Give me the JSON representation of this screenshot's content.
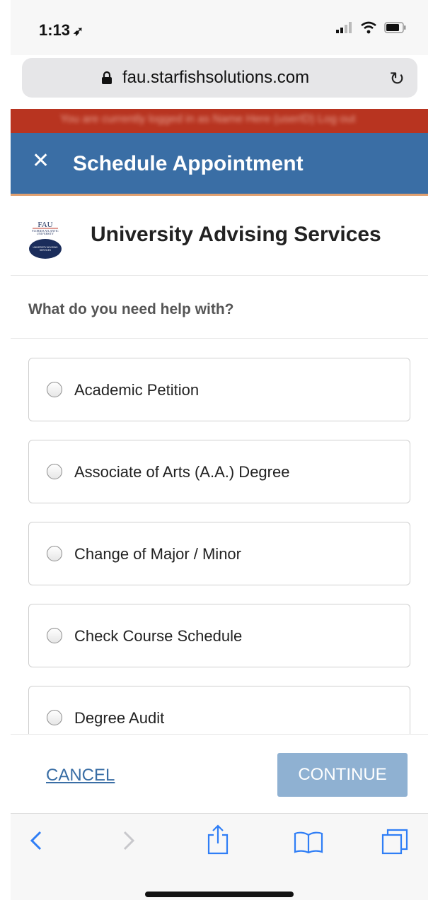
{
  "status_bar": {
    "time": "1:13",
    "location_arrow": "location-arrow-icon"
  },
  "browser": {
    "url": "fau.starfishsolutions.com",
    "lock_icon": "lock-icon",
    "reload_icon": "reload-icon"
  },
  "banner": {
    "text": "You are currently logged in as Name Here (userID) Log out"
  },
  "header": {
    "title": "Schedule Appointment",
    "close_icon": "close-icon"
  },
  "org": {
    "name": "University Advising Services",
    "logo": {
      "top": "FAU",
      "line2": "FLORIDA ATLANTIC",
      "line3": "UNIVERSITY",
      "seal_text": "UNIVERSITY ADVISING SERVICES"
    }
  },
  "question": "What do you need help with?",
  "options": [
    {
      "label": "Academic Petition"
    },
    {
      "label": "Associate of Arts (A.A.) Degree"
    },
    {
      "label": "Change of Major / Minor"
    },
    {
      "label": "Check Course Schedule"
    },
    {
      "label": "Degree Audit"
    }
  ],
  "footer": {
    "cancel": "CANCEL",
    "continue": "CONTINUE"
  },
  "colors": {
    "header_bg": "#3a6ea5",
    "banner_bg": "#b83420",
    "continue_bg": "#8fb1d2",
    "link": "#3a6ea5"
  }
}
